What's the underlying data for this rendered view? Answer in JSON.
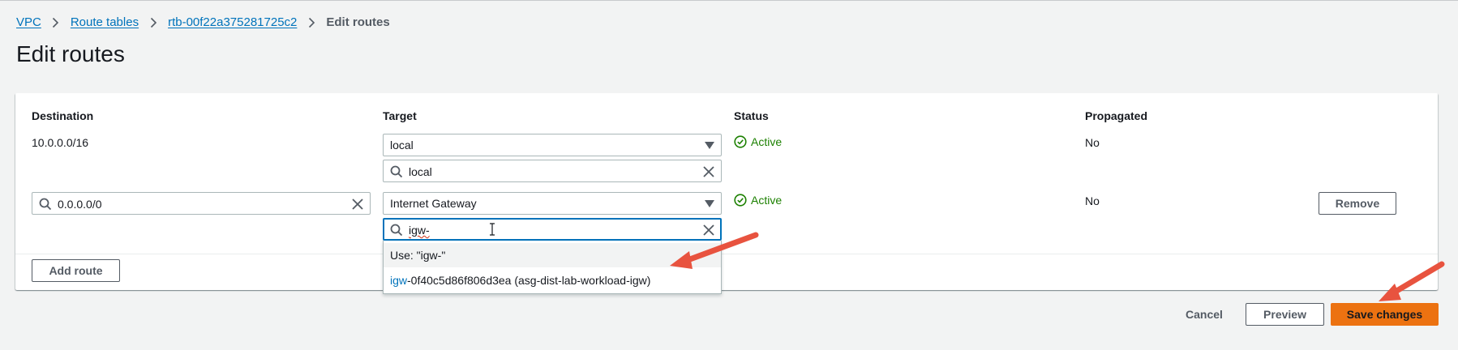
{
  "breadcrumb": {
    "items": [
      "VPC",
      "Route tables",
      "rtb-00f22a375281725c2"
    ],
    "current": "Edit routes"
  },
  "page": {
    "title": "Edit routes"
  },
  "table": {
    "headers": {
      "destination": "Destination",
      "target": "Target",
      "status": "Status",
      "propagated": "Propagated"
    },
    "rows": [
      {
        "destination": "10.0.0.0/16",
        "target_type": "local",
        "target_search": "local",
        "status": "Active",
        "propagated": "No"
      },
      {
        "destination": "0.0.0.0/0",
        "target_type": "Internet Gateway",
        "target_search": "igw-",
        "status": "Active",
        "propagated": "No",
        "remove_label": "Remove"
      }
    ],
    "add_route_label": "Add route"
  },
  "dropdown": {
    "use_option": "Use: \"igw-\"",
    "option_match": "igw",
    "option_rest": "-0f40c5d86f806d3ea (asg-dist-lab-workload-igw)"
  },
  "footer": {
    "cancel_label": "Cancel",
    "preview_label": "Preview",
    "save_label": "Save changes"
  },
  "colors": {
    "link": "#0073bb",
    "success": "#1d8102",
    "primary": "#ec7211",
    "annotation_arrow": "#e8533f"
  },
  "icons": [
    "chevron-right-icon",
    "caret-down-icon",
    "search-icon",
    "clear-icon",
    "check-circle-icon",
    "text-cursor-icon",
    "annotation-arrow-icon"
  ]
}
